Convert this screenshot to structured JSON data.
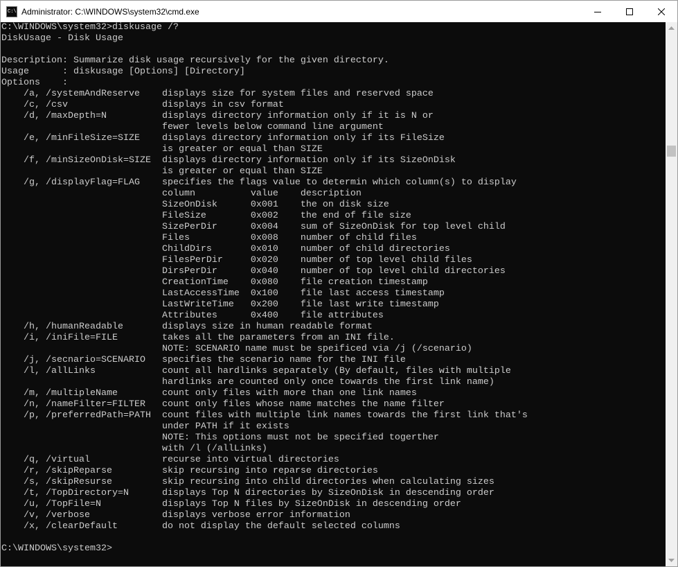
{
  "window": {
    "title": "Administrator: C:\\WINDOWS\\system32\\cmd.exe",
    "icon": "cmd-console-icon",
    "icon_label": "C:\\",
    "buttons": [
      "minimize-icon",
      "maximize-icon",
      "close-icon"
    ]
  },
  "colors": {
    "console_bg": "#0c0c0c",
    "console_fg": "#cccccc",
    "titlebar_bg": "#ffffff"
  },
  "console": {
    "lines": [
      "C:\\WINDOWS\\system32>diskusage /?",
      "DiskUsage - Disk Usage",
      "",
      "Description: Summarize disk usage recursively for the given directory.",
      "Usage      : diskusage [Options] [Directory]",
      "Options    :",
      "    /a, /systemAndReserve    displays size for system files and reserved space",
      "    /c, /csv                 displays in csv format",
      "    /d, /maxDepth=N          displays directory information only if it is N or",
      "                             fewer levels below command line argument",
      "    /e, /minFileSize=SIZE    displays directory information only if its FileSize",
      "                             is greater or equal than SIZE",
      "    /f, /minSizeOnDisk=SIZE  displays directory information only if its SizeOnDisk",
      "                             is greater or equal than SIZE",
      "    /g, /displayFlag=FLAG    specifies the flags value to determin which column(s) to display",
      "                             column          value    description",
      "                             SizeOnDisk      0x001    the on disk size",
      "                             FileSize        0x002    the end of file size",
      "                             SizePerDir      0x004    sum of SizeOnDisk for top level child",
      "                             Files           0x008    number of child files",
      "                             ChildDirs       0x010    number of child directories",
      "                             FilesPerDir     0x020    number of top level child files",
      "                             DirsPerDir      0x040    number of top level child directories",
      "                             CreationTime    0x080    file creation timestamp",
      "                             LastAccessTime  0x100    file last access timestamp",
      "                             LastWriteTime   0x200    file last write timestamp",
      "                             Attributes      0x400    file attributes",
      "    /h, /humanReadable       displays size in human readable format",
      "    /i, /iniFile=FILE        takes all the parameters from an INI file.",
      "                             NOTE: SCENARIO name must be speificed via /j (/scenario)",
      "    /j, /secnario=SCENARIO   specifies the scenario name for the INI file",
      "    /l, /allLinks            count all hardlinks separately (By default, files with multiple",
      "                             hardlinks are counted only once towards the first link name)",
      "    /m, /multipleName        count only files with more than one link names",
      "    /n, /nameFilter=FILTER   count only files whose name matches the name filter",
      "    /p, /preferredPath=PATH  count files with multiple link names towards the first link that's",
      "                             under PATH if it exists",
      "                             NOTE: This options must not be specified togerther",
      "                             with /l (/allLinks)",
      "    /q, /virtual             recurse into virtual directories",
      "    /r, /skipReparse         skip recursing into reparse directories",
      "    /s, /skipResurse         skip recursing into child directories when calculating sizes",
      "    /t, /TopDirectory=N      displays Top N directories by SizeOnDisk in descending order",
      "    /u, /TopFile=N           displays Top N files by SizeOnDisk in descending order",
      "    /v, /verbose             displays verbose error information",
      "    /x, /clearDefault        do not display the default selected columns",
      "",
      "C:\\WINDOWS\\system32>"
    ]
  }
}
